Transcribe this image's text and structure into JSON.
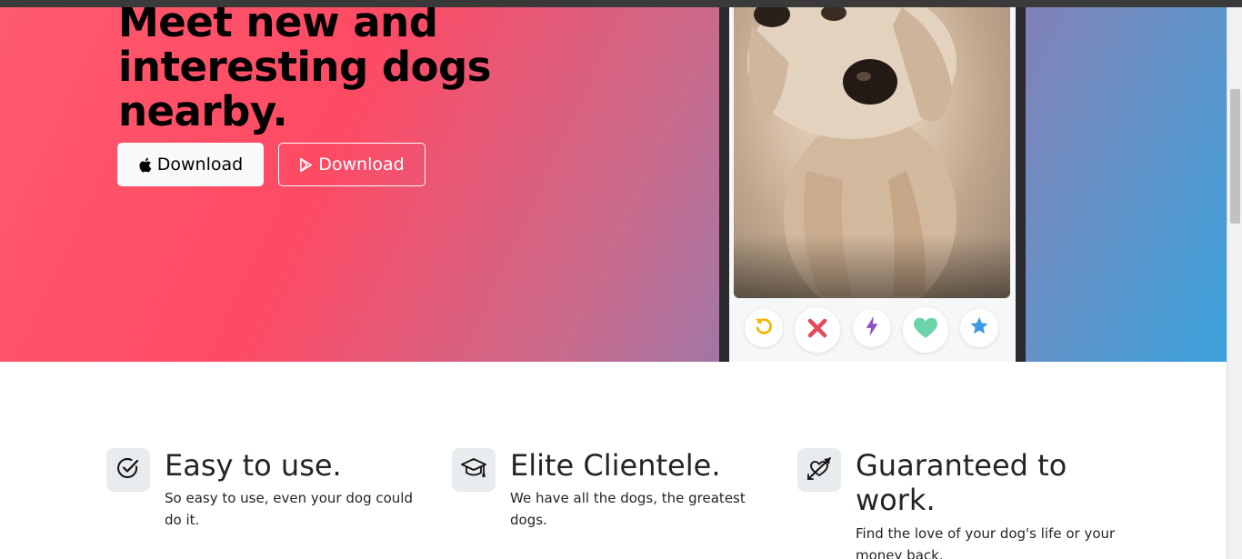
{
  "hero": {
    "headline": "Meet new and interesting dogs nearby.",
    "apple_button": {
      "label": "Download",
      "icon": "apple-icon"
    },
    "play_button": {
      "label": "Download",
      "icon": "google-play-icon"
    }
  },
  "phone": {
    "actions": [
      "undo-icon",
      "close-icon",
      "lightning-icon",
      "heart-icon",
      "star-icon"
    ]
  },
  "features": [
    {
      "icon": "check-circle-icon",
      "title": "Easy to use.",
      "text": "So easy to use, even your dog could do it."
    },
    {
      "icon": "graduation-cap-icon",
      "title": "Elite Clientele.",
      "text": "We have all the dogs, the greatest dogs."
    },
    {
      "icon": "heart-arrow-icon",
      "title": "Guaranteed to work.",
      "text": "Find the love of your dog's life or your money back."
    }
  ],
  "colors": {
    "brand_pink": "#ff4a64",
    "brand_blue": "#3aa1db",
    "undo": "#f5b800",
    "close": "#e8465a",
    "lightning": "#8a52c4",
    "heart": "#6dd3ab",
    "star": "#3a9ae3"
  }
}
